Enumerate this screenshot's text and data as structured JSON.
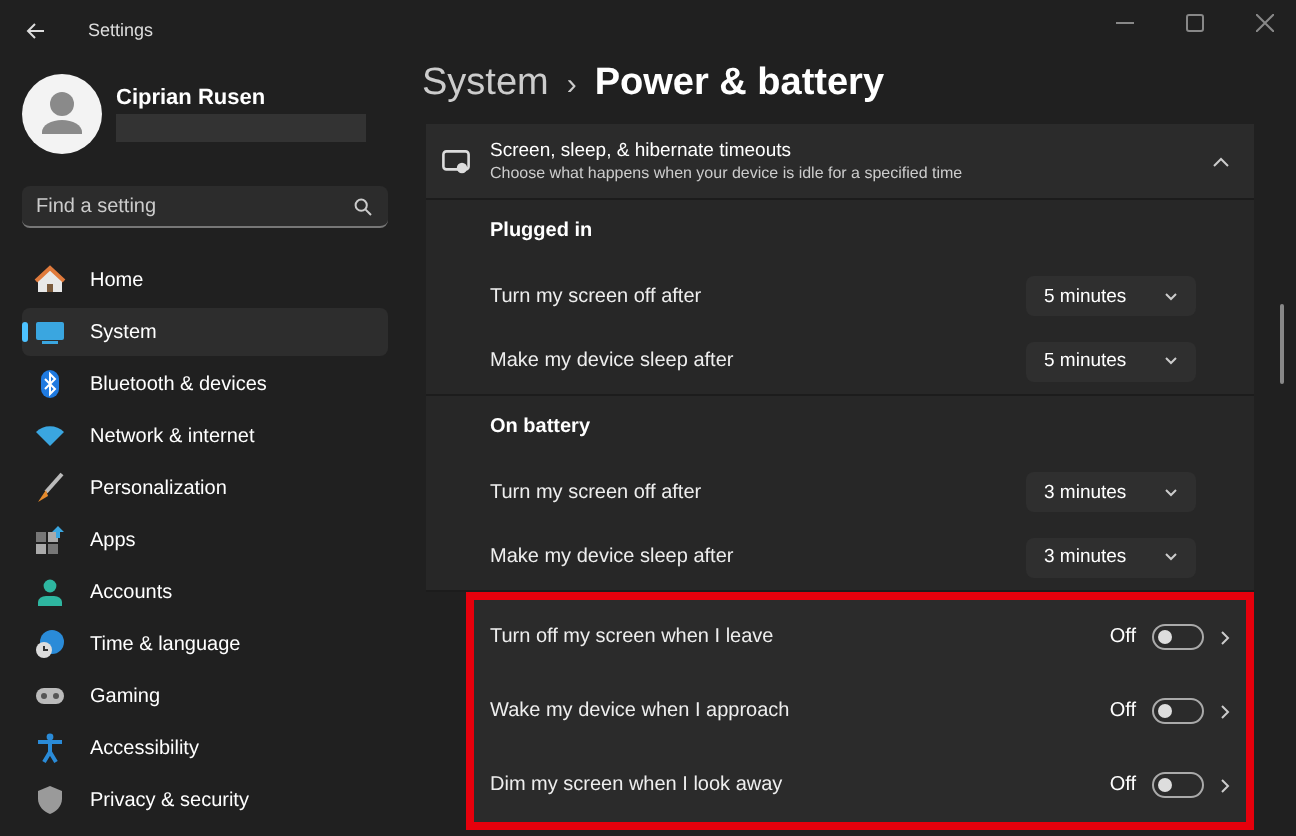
{
  "window": {
    "title": "Settings"
  },
  "account": {
    "name": "Ciprian Rusen"
  },
  "search": {
    "placeholder": "Find a setting"
  },
  "nav": [
    {
      "label": "Home",
      "selected": false
    },
    {
      "label": "System",
      "selected": true
    },
    {
      "label": "Bluetooth & devices",
      "selected": false
    },
    {
      "label": "Network & internet",
      "selected": false
    },
    {
      "label": "Personalization",
      "selected": false
    },
    {
      "label": "Apps",
      "selected": false
    },
    {
      "label": "Accounts",
      "selected": false
    },
    {
      "label": "Time & language",
      "selected": false
    },
    {
      "label": "Gaming",
      "selected": false
    },
    {
      "label": "Accessibility",
      "selected": false
    },
    {
      "label": "Privacy & security",
      "selected": false
    }
  ],
  "breadcrumb": {
    "parent": "System",
    "separator": "›",
    "current": "Power & battery"
  },
  "timeouts": {
    "title": "Screen, sleep, & hibernate timeouts",
    "description": "Choose what happens when your device is idle for a specified time",
    "expanded": true,
    "groups": [
      {
        "heading": "Plugged in",
        "rows": [
          {
            "label": "Turn my screen off after",
            "value": "5 minutes"
          },
          {
            "label": "Make my device sleep after",
            "value": "5 minutes"
          }
        ]
      },
      {
        "heading": "On battery",
        "rows": [
          {
            "label": "Turn my screen off after",
            "value": "3 minutes"
          },
          {
            "label": "Make my device sleep after",
            "value": "3 minutes"
          }
        ]
      }
    ]
  },
  "presence": [
    {
      "label": "Turn off my screen when I leave",
      "status": "Off",
      "on": false
    },
    {
      "label": "Wake my device when I approach",
      "status": "Off",
      "on": false
    },
    {
      "label": "Dim my screen when I look away",
      "status": "Off",
      "on": false
    }
  ]
}
